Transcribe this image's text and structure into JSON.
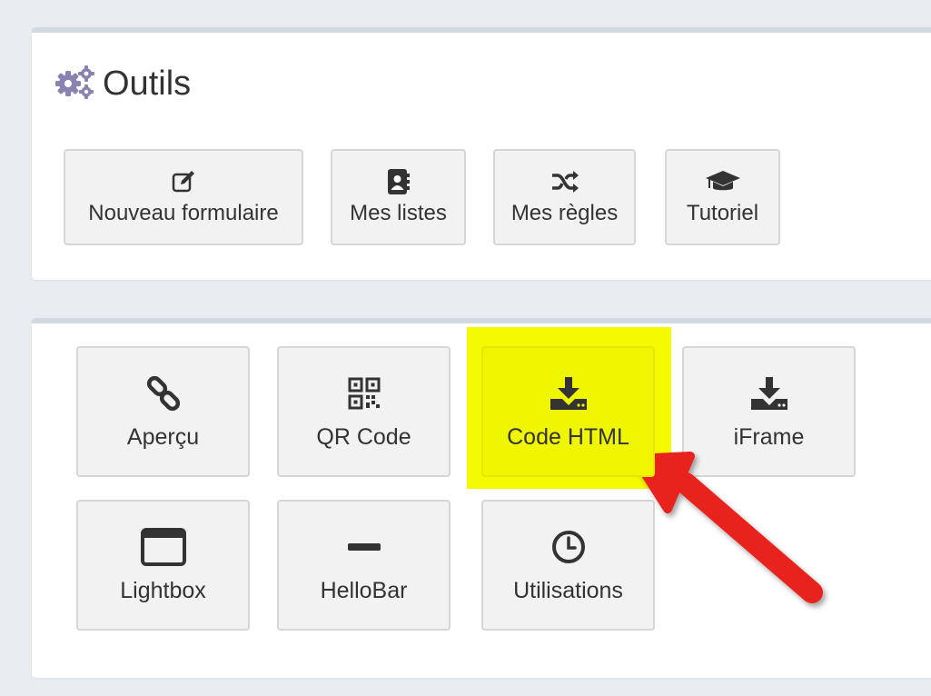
{
  "outils": {
    "title": "Outils",
    "buttons": [
      {
        "label": "Nouveau formulaire",
        "icon": "edit-icon"
      },
      {
        "label": "Mes listes",
        "icon": "address-book-icon"
      },
      {
        "label": "Mes règles",
        "icon": "shuffle-icon"
      },
      {
        "label": "Tutoriel",
        "icon": "graduation-cap-icon"
      }
    ]
  },
  "tools": {
    "buttons": [
      {
        "label": "Aperçu",
        "icon": "link-icon"
      },
      {
        "label": "QR Code",
        "icon": "qrcode-icon"
      },
      {
        "label": "Code HTML",
        "icon": "download-icon"
      },
      {
        "label": "iFrame",
        "icon": "download-icon"
      },
      {
        "label": "Lightbox",
        "icon": "window-icon"
      },
      {
        "label": "HelloBar",
        "icon": "minus-icon"
      },
      {
        "label": "Utilisations",
        "icon": "clock-icon"
      }
    ]
  },
  "colors": {
    "icon_purple": "#8a82b0",
    "highlight": "#f4fa00",
    "arrow": "#e8231a",
    "icon_dark": "#333333"
  }
}
